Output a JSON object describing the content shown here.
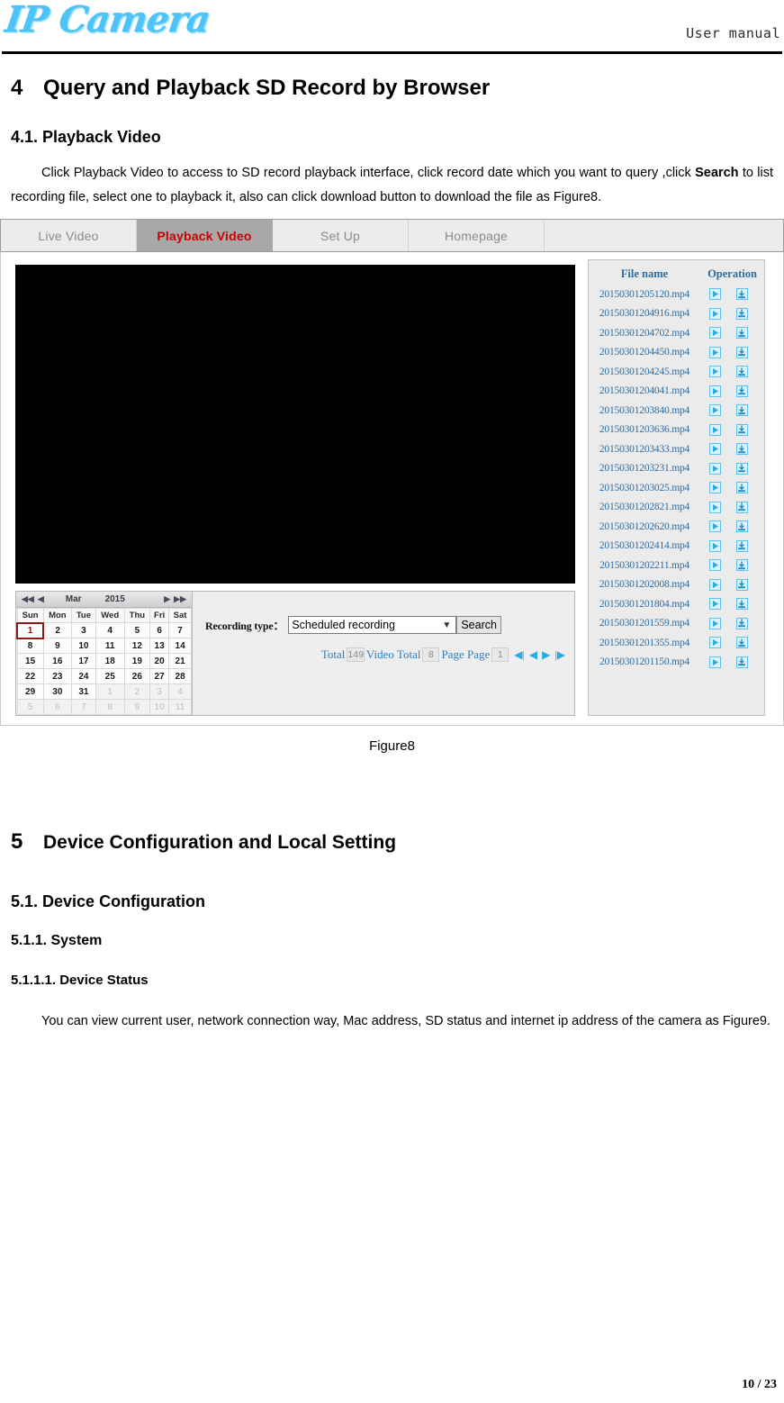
{
  "header": {
    "logo_text": "IP Camera",
    "manual_label": "User manual"
  },
  "document": {
    "h_4_num": "4",
    "h_4_title": "Query and Playback SD Record by Browser",
    "h_41": "4.1. Playback Video",
    "para_1_a": "Click Playback Video to access to SD record playback interface, click record date which you want to query ,click ",
    "para_1_bold": "Search",
    "para_1_b": " to list recording file, select one to playback it, also can click download button to download the file as Figure8.",
    "figure_caption": "Figure8",
    "h_5_num": "5",
    "h_5_title": "Device Configuration and Local Setting",
    "h_51": "5.1. Device Configuration",
    "h_511": "5.1.1.  System",
    "h_5111": "5.1.1.1. Device Status",
    "para_2": "You can view current user, network connection way, Mac address, SD status and internet ip address of the camera as Figure9.",
    "page_number": "10 / 23"
  },
  "app": {
    "tabs": [
      {
        "label": "Live Video",
        "active": false
      },
      {
        "label": "Playback Video",
        "active": true
      },
      {
        "label": "Set Up",
        "active": false
      },
      {
        "label": "Homepage",
        "active": false
      }
    ],
    "calendar": {
      "first_prev_icon": "double-left-arrow",
      "prev_icon": "left-arrow",
      "month": "Mar",
      "year": "2015",
      "next_icon": "right-arrow",
      "last_next_icon": "double-right-arrow",
      "weekdays": [
        "Sun",
        "Mon",
        "Tue",
        "Wed",
        "Thu",
        "Fri",
        "Sat"
      ],
      "selected_day": "1",
      "weeks": [
        [
          {
            "d": "1",
            "dim": false,
            "sel": true
          },
          {
            "d": "2",
            "dim": false
          },
          {
            "d": "3",
            "dim": false
          },
          {
            "d": "4",
            "dim": false
          },
          {
            "d": "5",
            "dim": false
          },
          {
            "d": "6",
            "dim": false
          },
          {
            "d": "7",
            "dim": false
          }
        ],
        [
          {
            "d": "8",
            "dim": false
          },
          {
            "d": "9",
            "dim": false
          },
          {
            "d": "10",
            "dim": false
          },
          {
            "d": "11",
            "dim": false
          },
          {
            "d": "12",
            "dim": false
          },
          {
            "d": "13",
            "dim": false
          },
          {
            "d": "14",
            "dim": false
          }
        ],
        [
          {
            "d": "15",
            "dim": false
          },
          {
            "d": "16",
            "dim": false
          },
          {
            "d": "17",
            "dim": false
          },
          {
            "d": "18",
            "dim": false
          },
          {
            "d": "19",
            "dim": false
          },
          {
            "d": "20",
            "dim": false
          },
          {
            "d": "21",
            "dim": false
          }
        ],
        [
          {
            "d": "22",
            "dim": false
          },
          {
            "d": "23",
            "dim": false
          },
          {
            "d": "24",
            "dim": false
          },
          {
            "d": "25",
            "dim": false
          },
          {
            "d": "26",
            "dim": false
          },
          {
            "d": "27",
            "dim": false
          },
          {
            "d": "28",
            "dim": false
          }
        ],
        [
          {
            "d": "29",
            "dim": false
          },
          {
            "d": "30",
            "dim": false
          },
          {
            "d": "31",
            "dim": false
          },
          {
            "d": "1",
            "dim": true
          },
          {
            "d": "2",
            "dim": true
          },
          {
            "d": "3",
            "dim": true
          },
          {
            "d": "4",
            "dim": true
          }
        ],
        [
          {
            "d": "5",
            "dim": true
          },
          {
            "d": "6",
            "dim": true
          },
          {
            "d": "7",
            "dim": true
          },
          {
            "d": "8",
            "dim": true
          },
          {
            "d": "9",
            "dim": true
          },
          {
            "d": "10",
            "dim": true
          },
          {
            "d": "11",
            "dim": true
          }
        ]
      ]
    },
    "search": {
      "recording_type_label": "Recording type：",
      "recording_type_value": "Scheduled recording",
      "search_button": "Search",
      "total_label": "Total",
      "total_value": "149",
      "video_total_label": "Video Total",
      "video_total_value": "8",
      "page_label": "Page Page",
      "page_value": "1",
      "nav_first_icon": "first-page-icon",
      "nav_prev_icon": "prev-page-icon",
      "nav_next_icon": "next-page-icon",
      "nav_last_icon": "last-page-icon"
    },
    "filelist": {
      "col_name": "File name",
      "col_operation": "Operation",
      "play_icon": "play-icon",
      "download_icon": "download-icon",
      "files": [
        "20150301205120.mp4",
        "20150301204916.mp4",
        "20150301204702.mp4",
        "20150301204450.mp4",
        "20150301204245.mp4",
        "20150301204041.mp4",
        "20150301203840.mp4",
        "20150301203636.mp4",
        "20150301203433.mp4",
        "20150301203231.mp4",
        "20150301203025.mp4",
        "20150301202821.mp4",
        "20150301202620.mp4",
        "20150301202414.mp4",
        "20150301202211.mp4",
        "20150301202008.mp4",
        "20150301201804.mp4",
        "20150301201559.mp4",
        "20150301201355.mp4",
        "20150301201150.mp4"
      ]
    },
    "video_player": {
      "state": "black-screen"
    }
  },
  "colors": {
    "logo": "#4ec3f7",
    "active_tab_text": "#cc0000",
    "active_tab_bg": "#a8a8a8",
    "link_blue": "#2d6da3",
    "icon_blue": "#29abe2",
    "selected_day": "#c00000"
  }
}
